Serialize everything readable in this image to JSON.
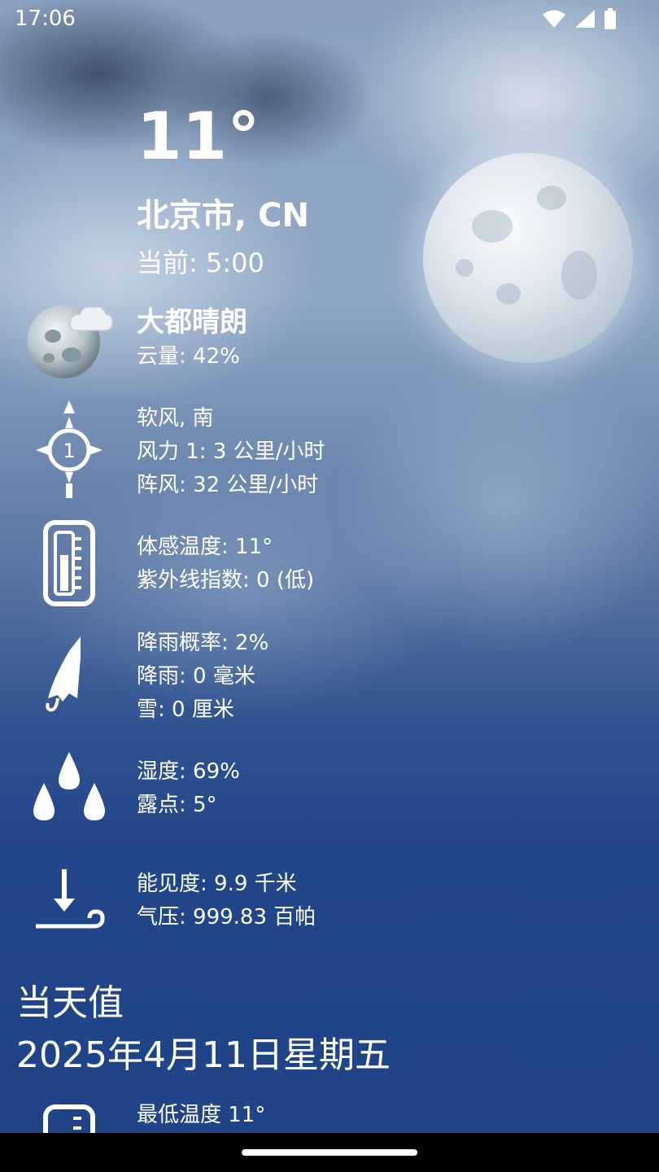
{
  "status_bar": {
    "time": "17:06",
    "icons": [
      "wifi-icon",
      "signal-icon",
      "battery-icon"
    ]
  },
  "current": {
    "temperature": "11°",
    "city": "北京市, CN",
    "time_label": "当前: 5:00"
  },
  "condition": {
    "icon": "moon-cloud-icon",
    "title": "大都晴朗",
    "cloud_cover": "云量: 42%"
  },
  "wind": {
    "icon": "wind-compass-icon",
    "compass_number": "1",
    "description": "软风, 南",
    "force": "风力 1: 3 公里/小时",
    "gust": "阵风: 32 公里/小时"
  },
  "feels": {
    "icon": "thermometer-icon",
    "feels_like": "体感温度: 11°",
    "uv_index": "紫外线指数: 0 (低)"
  },
  "precipitation": {
    "icon": "umbrella-icon",
    "chance": "降雨概率: 2%",
    "rain": "降雨: 0 毫米",
    "snow": "雪: 0 厘米"
  },
  "humidity": {
    "icon": "water-drops-icon",
    "humidity": "湿度: 69%",
    "dew_point": "露点: 5°"
  },
  "pressure": {
    "icon": "pressure-icon",
    "visibility": "能见度: 9.9 千米",
    "pressure": "气压: 999.83 百帕"
  },
  "daily": {
    "section_title": "当天值",
    "date": "2025年4月11日星期五",
    "min_temp": "最低温度 11°"
  },
  "colors": {
    "text": "#ffffff",
    "bottom_blue": "#1f4386",
    "nav_bar": "#000000"
  }
}
